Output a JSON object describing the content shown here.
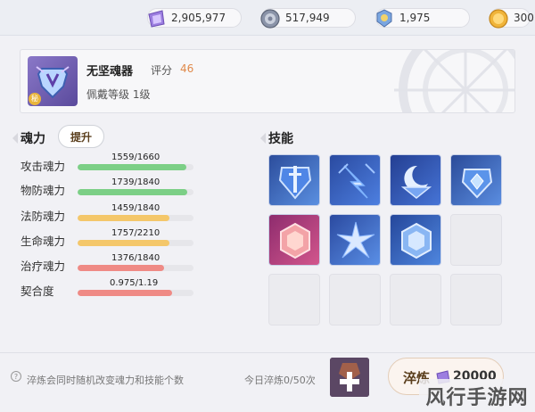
{
  "currencies": [
    {
      "icon": "soul-crystal-icon",
      "value": "2,905,977"
    },
    {
      "icon": "silver-coin-icon",
      "value": "517,949"
    },
    {
      "icon": "soul-token-icon",
      "value": "1,975"
    },
    {
      "icon": "gold-coin-icon",
      "value": "300"
    }
  ],
  "soul": {
    "name": "无坚魂器",
    "score_label": "评分",
    "score": "46",
    "level": "佩戴等级 1级",
    "badge": "秘"
  },
  "stats_section": {
    "title": "魂力",
    "upgrade_label": "提升",
    "stats": [
      {
        "label": "攻击魂力",
        "value": "1559/1660",
        "fraction": 0.939,
        "color": "#7ccf86"
      },
      {
        "label": "物防魂力",
        "value": "1739/1840",
        "fraction": 0.945,
        "color": "#7ccf86"
      },
      {
        "label": "法防魂力",
        "value": "1459/1840",
        "fraction": 0.793,
        "color": "#f4c76a"
      },
      {
        "label": "生命魂力",
        "value": "1757/2210",
        "fraction": 0.795,
        "color": "#f4c76a"
      },
      {
        "label": "治疗魂力",
        "value": "1376/1840",
        "fraction": 0.748,
        "color": "#ef8a85"
      },
      {
        "label": "契合度",
        "value": "0.975/1.19",
        "fraction": 0.819,
        "color": "#ef8a85"
      }
    ]
  },
  "skills_section": {
    "title": "技能",
    "skills": [
      {
        "icon": "shield-sword-skill-icon"
      },
      {
        "icon": "lightning-arrow-skill-icon"
      },
      {
        "icon": "crescent-shield-skill-icon"
      },
      {
        "icon": "gem-shield-skill-icon"
      },
      {
        "icon": "pink-hexagon-skill-icon"
      },
      {
        "icon": "crystal-burst-skill-icon"
      },
      {
        "icon": "blue-hexagon-skill-icon"
      }
    ]
  },
  "footer": {
    "hint": "淬炼会同时随机改变魂力和技能个数",
    "daily": "今日淬炼0/50次",
    "refine_label": "淬炼",
    "refine_cost": "20000"
  },
  "watermark": "风行手游网"
}
